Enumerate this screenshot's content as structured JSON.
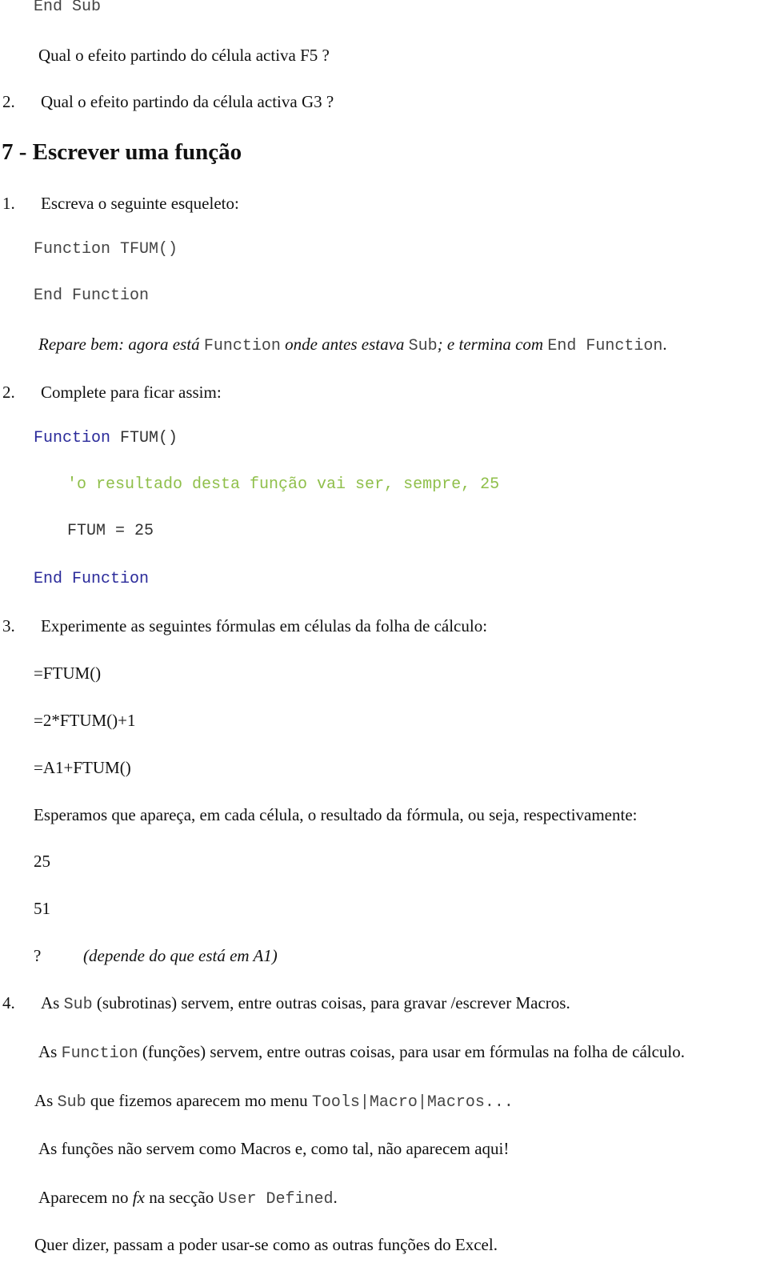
{
  "code_top": "End Sub",
  "q1": "Qual o efeito partindo do célula activa F5 ?",
  "q2_num": "2.",
  "q2": "Qual o efeito partindo da célula activa G3 ?",
  "heading": "7 - Escrever uma função",
  "step1": {
    "num": "1.",
    "text": "Escreva o seguinte esqueleto:"
  },
  "skeleton": {
    "line1": "Function TFUM()",
    "line2": "End Function"
  },
  "note": {
    "p1": "Repare bem: agora está ",
    "c1": "Function",
    "p2": " onde antes estava ",
    "c2": "Sub",
    "p3": "; e termina com ",
    "c3": "End Function",
    "p4": "."
  },
  "step2": {
    "num": "2.",
    "text": "Complete para ficar assim:"
  },
  "code": {
    "kw1": "Function",
    "name": " FTUM()",
    "comment": "'o resultado desta função vai ser, sempre, 25",
    "assign": "FTUM = 25",
    "end": "End Function"
  },
  "step3": {
    "num": "3.",
    "text": "Experimente as seguintes fórmulas em células da folha de cálculo:"
  },
  "formulas": [
    "=FTUM()",
    "=2*FTUM()+1",
    "=A1+FTUM()"
  ],
  "expect": "Esperamos que apareça, em cada célula, o resultado da fórmula, ou seja, respectivamente:",
  "results": [
    "25",
    "51"
  ],
  "unknown": {
    "mark": "?",
    "note": "(depende do que está em A1)"
  },
  "step4": {
    "num": "4.",
    "l1a": "As ",
    "l1c": "Sub",
    "l1b": " (subrotinas) servem, entre outras coisas, para gravar /escrever Macros.",
    "l2a": "As ",
    "l2c": "Function",
    "l2b": " (funções) servem, entre outras coisas, para usar em fórmulas na folha de cálculo.",
    "l3a": "As ",
    "l3c": "Sub",
    "l3b": " que fizemos aparecem mo menu ",
    "l3d": "Tools|Macro|Macros...",
    "l4": "As funções não servem como Macros e, como tal, não aparecem aqui!",
    "l5a": "Aparecem no ",
    "l5i": "fx",
    "l5b": " na secção ",
    "l5c": "User Defined",
    "l5d": ".",
    "l6": "Quer dizer, passam a poder usar-se como as outras funções do Excel."
  }
}
